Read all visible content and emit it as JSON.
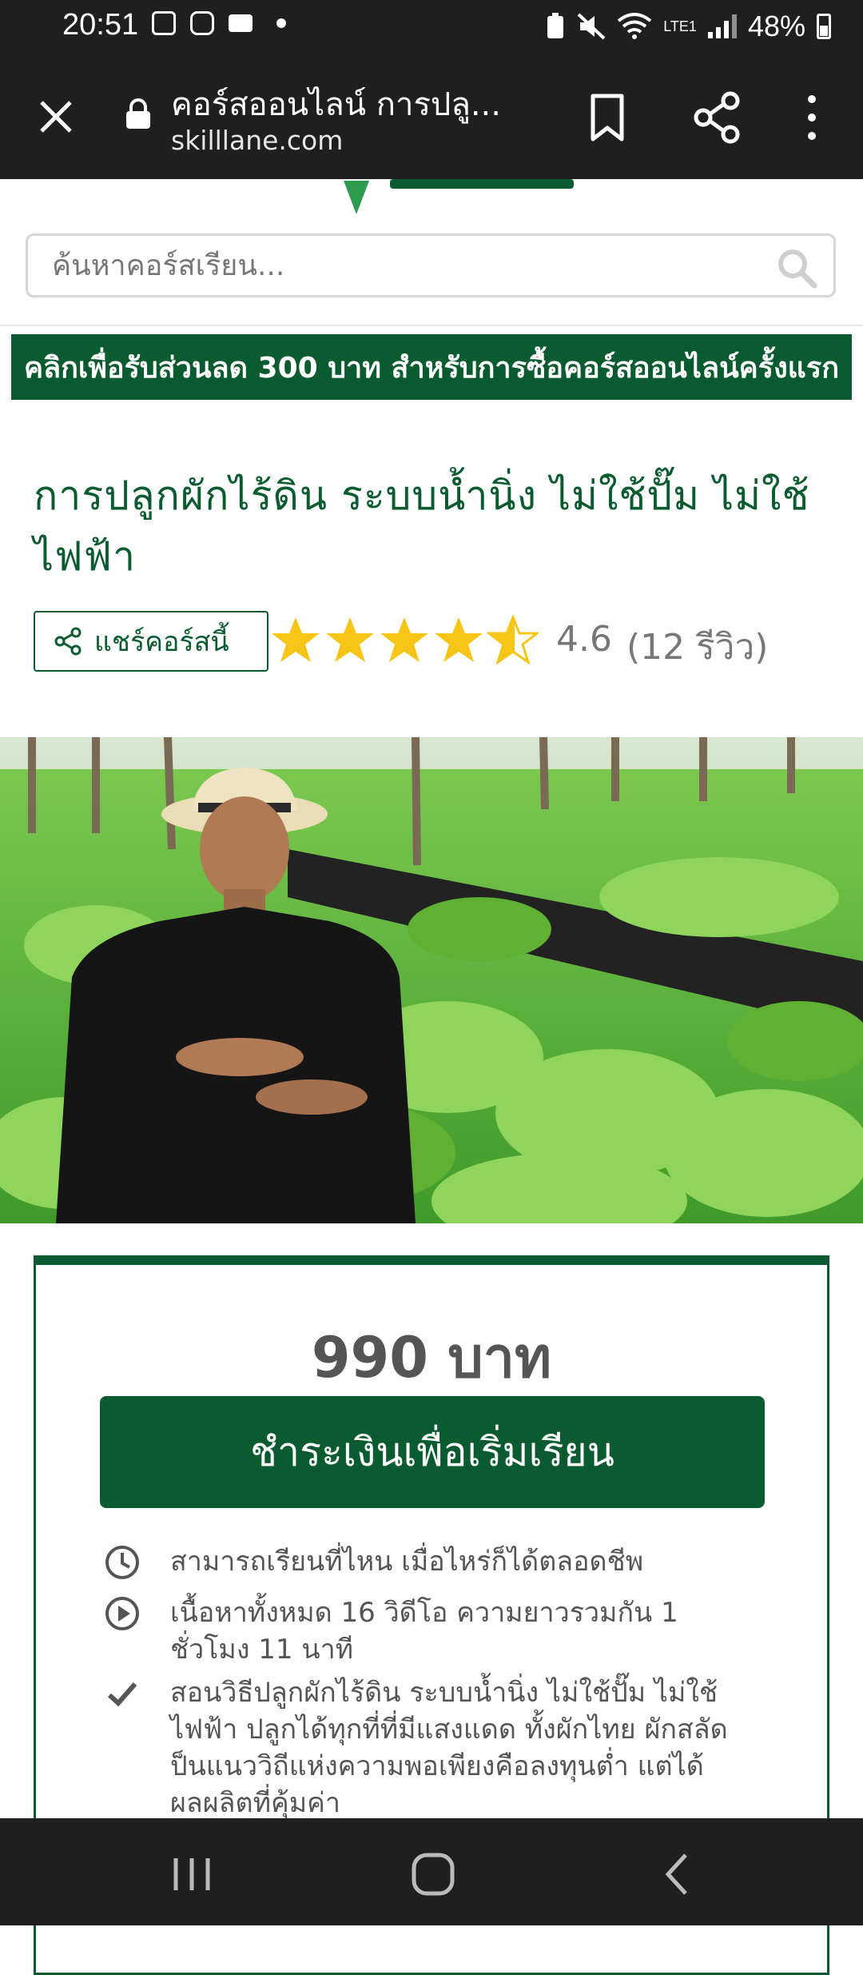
{
  "status_bar": {
    "time": "20:51",
    "battery": "48%",
    "network": "LTE1"
  },
  "browser": {
    "tab_title": "คอร์สออนไลน์ การปลู...",
    "domain": "skilllane.com"
  },
  "search": {
    "placeholder": "ค้นหาคอร์สเรียน..."
  },
  "promo_banner": "คลิกเพื่อรับส่วนลด 300 บาท สำหรับการซื้อคอร์สออนไลน์ครั้งแรก",
  "course": {
    "title": "การปลูกผักไร้ดิน ระบบน้ำนิ่ง ไม่ใช้ปั๊ม ไม่ใช้ไฟฟ้า",
    "share_label": "แชร์คอร์สนี้",
    "rating": 4.6,
    "rating_text": "4.6",
    "reviews_text": "(12 รีวิว)"
  },
  "pricing": {
    "price": "990 บาท",
    "pay_button": "ชำระเงินเพื่อเริ่มเรียน",
    "features": [
      {
        "icon": "clock-icon",
        "text": "สามารถเรียนที่ไหน เมื่อไหร่ก็ได้ตลอดชีพ"
      },
      {
        "icon": "play-circle-icon",
        "text": "เนื้อหาทั้งหมด 16 วิดีโอ ความยาวรวมกัน 1 ชั่วโมง 11 นาที"
      },
      {
        "icon": "check-icon",
        "text": "สอนวิธีปลูกผักไร้ดิน ระบบน้ำนิ่ง ไม่ใช้ปั๊ม ไม่ใช้ไฟฟ้า ปลูกได้ทุกที่ที่มีแสงแดด ทั้งผักไทย ผักสลัด ป็นแนววิถีแห่งความพอเพียงคือลงทุนต่ำ แต่ได้ผลผลิตที่คุ้มค่า"
      }
    ]
  },
  "colors": {
    "brand_green": "#0b5b30",
    "star_yellow": "#f6c518",
    "chrome_dark": "#1f1f1f"
  }
}
